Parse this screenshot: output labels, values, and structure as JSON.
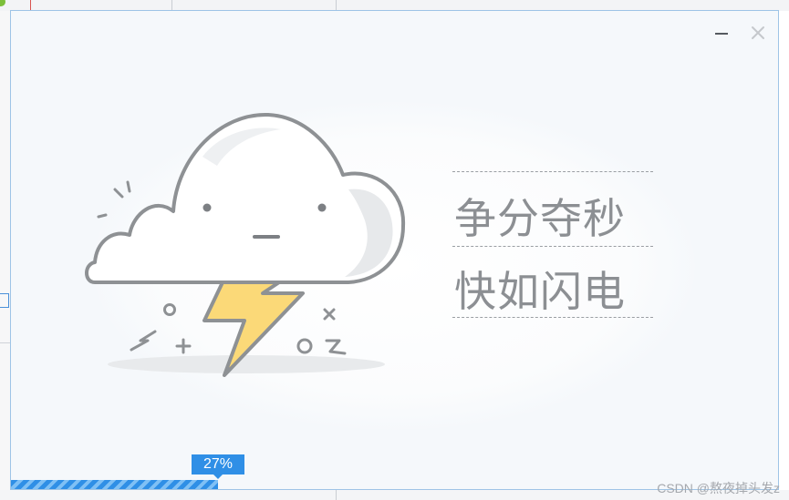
{
  "window": {
    "minimize_icon": "minimize-icon",
    "close_icon": "close-icon"
  },
  "illustration": {
    "icons": [
      "cloud-icon",
      "lightning-bolt-icon"
    ]
  },
  "slogan": {
    "line1": "争分夺秒",
    "line2": "快如闪电"
  },
  "progress": {
    "value": 0.27,
    "label": "27%"
  },
  "watermark": "CSDN @熬夜掉头发z",
  "colors": {
    "accent": "#2f8fe6",
    "bolt_fill": "#fbd978",
    "outline": "#8e9194",
    "window_border": "#9ec4e6"
  }
}
